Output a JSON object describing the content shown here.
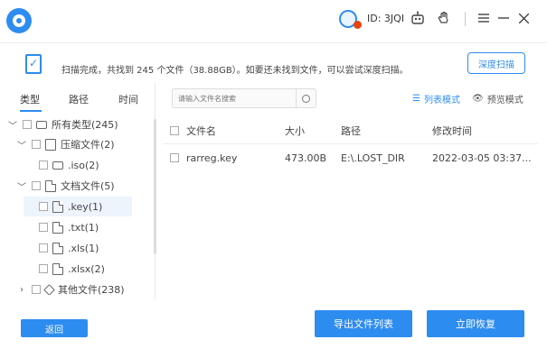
{
  "titlebar": {
    "user_id": "ID: 3JQI",
    "icons": [
      "robot-icon",
      "hand-icon",
      "menu-icon",
      "minimize-icon",
      "close-icon"
    ]
  },
  "banner": {
    "message": "扫描完成，共找到 245 个文件（38.88GB）。如要还未找到文件，可以尝试深度扫描。",
    "deep_scan_label": "深度扫描"
  },
  "left_tabs": [
    "类型",
    "路径",
    "时间"
  ],
  "tree": [
    {
      "label": "所有类型(245)",
      "icon": "drive-icon",
      "chevron": "down"
    },
    {
      "label": "压缩文件(2)",
      "icon": "archive-icon",
      "chevron": "down"
    },
    {
      "label": ".iso(2)",
      "icon": "disc-icon",
      "chevron": ""
    },
    {
      "label": "文档文件(5)",
      "icon": "document-icon",
      "chevron": "down"
    },
    {
      "label": ".key(1)",
      "icon": "document-icon",
      "chevron": ""
    },
    {
      "label": ".txt(1)",
      "icon": "document-icon",
      "chevron": ""
    },
    {
      "label": ".xls(1)",
      "icon": "document-icon",
      "chevron": ""
    },
    {
      "label": ".xlsx(2)",
      "icon": "document-icon",
      "chevron": ""
    },
    {
      "label": "其他文件(238)",
      "icon": "other-file-icon",
      "chevron": "right"
    }
  ],
  "search": {
    "placeholder": "请输入文件名搜索"
  },
  "view_modes": {
    "list": "列表模式",
    "preview": "预览模式"
  },
  "table": {
    "columns": [
      "文件名",
      "大小",
      "路径",
      "修改时间"
    ],
    "rows": [
      {
        "name": "rarreg.key",
        "size": "473.00B",
        "path": "E:\\.LOST_DIR",
        "modified": "2022-03-05 03:37..."
      }
    ]
  },
  "buttons": {
    "back": "返回",
    "export": "导出文件列表",
    "recover": "立即恢复"
  },
  "colors": {
    "accent": "#2d8cf0",
    "badge": "#e8430f"
  }
}
